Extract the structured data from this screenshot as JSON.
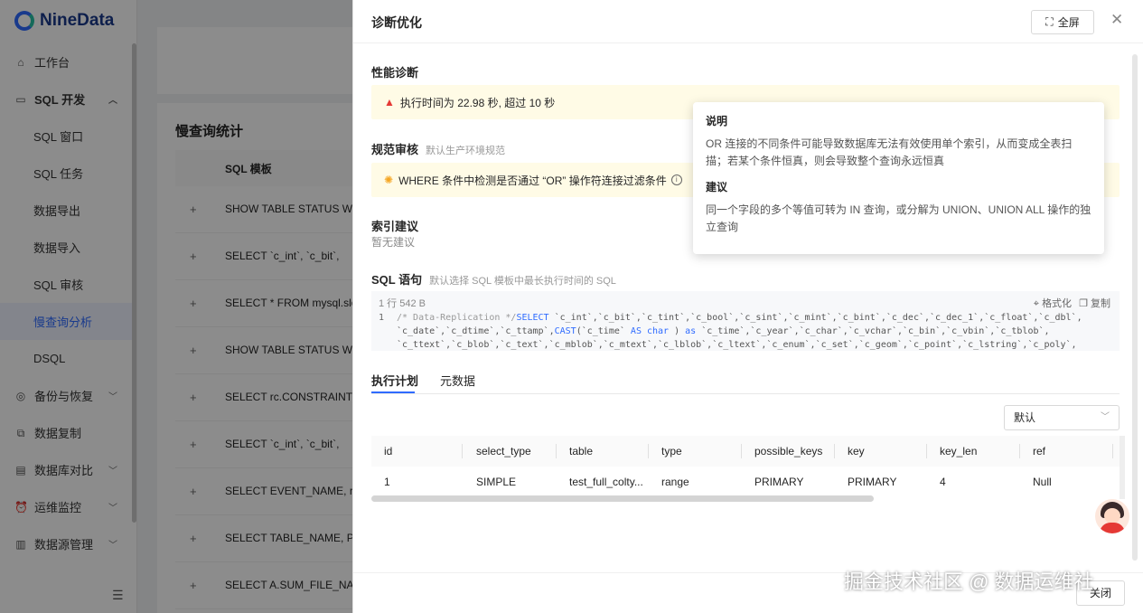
{
  "app": {
    "logo_text": "NineData",
    "nav": [
      {
        "label": "工作台",
        "icon": "home-icon"
      },
      {
        "label": "SQL 开发",
        "icon": "monitor-icon"
      },
      {
        "label": "SQL 窗口"
      },
      {
        "label": "SQL 任务"
      },
      {
        "label": "数据导出"
      },
      {
        "label": "数据导入"
      },
      {
        "label": "SQL 审核"
      },
      {
        "label": "慢查询分析"
      },
      {
        "label": "DSQL"
      },
      {
        "label": "备份与恢复",
        "icon": "backup-icon"
      },
      {
        "label": "数据复制",
        "icon": "copy-icon"
      },
      {
        "label": "数据库对比",
        "icon": "compare-icon"
      },
      {
        "label": "运维监控",
        "icon": "monitor-alarm-icon"
      },
      {
        "label": "数据源管理",
        "icon": "datasource-icon"
      }
    ],
    "bg_card": {
      "title": "慢查询统计",
      "column": "SQL 模板",
      "rows": [
        "SHOW TABLE STATUS WH",
        "SELECT `c_int`, `c_bit`,",
        "SELECT * FROM mysql.slo",
        "SHOW TABLE STATUS WH",
        "SELECT rc.CONSTRAINT_",
        "SELECT `c_int`, `c_bit`,",
        "SELECT EVENT_NAME, rc",
        "SELECT TABLE_NAME, PA",
        "SELECT A.SUM_FILE_NA"
      ]
    }
  },
  "drawer": {
    "title": "诊断优化",
    "fullscreen_label": "全屏",
    "perf_title": "性能诊断",
    "perf_alert": "执行时间为 22.98 秒, 超过 10 秒",
    "review_title": "规范审核",
    "review_hint": "默认生产环境规范",
    "review_alert": "WHERE 条件中检测是否通过 “OR” 操作符连接过滤条件",
    "index_title": "索引建议",
    "index_none": "暂无建议",
    "sql_title": "SQL 语句",
    "sql_hint": "默认选择 SQL 模板中最长执行时间的 SQL",
    "code_meta": "1 行   542 B",
    "format_label": "格式化",
    "copy_label": "复制",
    "code_line1_num": "1",
    "code_comment": "/* Data-Replication */",
    "code_select": "SELECT",
    "code_line1_rest": " `c_int`,`c_bit`,`c_tint`,`c_bool`,`c_sint`,`c_mint`,`c_bint`,`c_dec`,`c_dec_1`,`c_float`,`c_dbl`,",
    "code_line2_a": "`c_date`,`c_dtime`,`c_ttamp`,",
    "code_cast": "CAST",
    "code_line2_b": "(`c_time` ",
    "code_as": "AS",
    "code_char": "char",
    "code_line2_c": " ) ",
    "code_as2": "as",
    "code_line2_d": " `c_time`,`c_year`,`c_char`,`c_vchar`,`c_bin`,`c_vbin`,`c_tblob`,",
    "code_line3": "`c_ttext`,`c_blob`,`c_text`,`c_mblob`,`c_mtext`,`c_lblob`,`c_ltext`,`c_enum`,`c_set`,`c_geom`,`c_point`,`c_lstring`,`c_poly`,",
    "tabs": [
      "执行计划",
      "元数据"
    ],
    "select_value": "默认",
    "plan_columns": [
      "id",
      "select_type",
      "table",
      "type",
      "possible_keys",
      "key",
      "key_len",
      "ref"
    ],
    "plan_rows": [
      [
        "1",
        "SIMPLE",
        "test_full_colty...",
        "range",
        "PRIMARY",
        "PRIMARY",
        "4",
        "Null"
      ]
    ],
    "close_label": "关闭"
  },
  "tooltip": {
    "h1": "说明",
    "p1": "OR 连接的不同条件可能导致数据库无法有效使用单个索引，从而变成全表扫描；若某个条件恒真，则会导致整个查询永远恒真",
    "h2": "建议",
    "p2": "同一个字段的多个等值可转为 IN 查询，或分解为 UNION、UNION ALL 操作的独立查询"
  },
  "watermark": "掘金技术社区 @ 数据运维社"
}
